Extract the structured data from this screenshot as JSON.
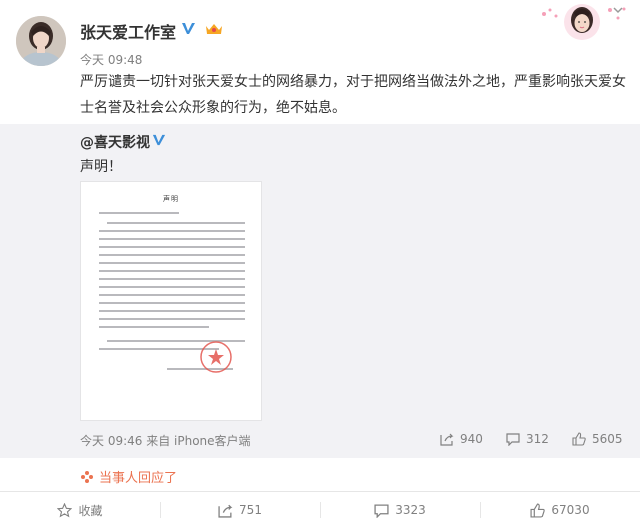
{
  "post": {
    "username": "张天爱工作室",
    "time": "今天 09:48",
    "text": "严厉谴责一切针对张天爱女士的网络暴力，对于把网络当做法外之地，严重影响张天爱女士名誉及社会公众形象的行为，绝不姑息。"
  },
  "repost": {
    "username": "@喜天影视",
    "text": "声明！",
    "document_title": "声明",
    "meta": "今天 09:46 来自 iPhone客户端",
    "shares": "940",
    "comments": "312",
    "likes": "5605"
  },
  "reply_notice": "当事人回应了",
  "footer": {
    "favorite": "收藏",
    "shares": "751",
    "comments": "3323",
    "likes": "67030"
  },
  "colors": {
    "accent": "#eb7350",
    "verified": "#3d8fd9",
    "repost_bg": "#f2f2f5",
    "muted": "#808080"
  },
  "icons": [
    "chevron-down-icon",
    "verified-icon",
    "vip-icon",
    "share-icon",
    "comment-icon",
    "like-icon",
    "favorite-icon",
    "reply-flower-icon"
  ]
}
